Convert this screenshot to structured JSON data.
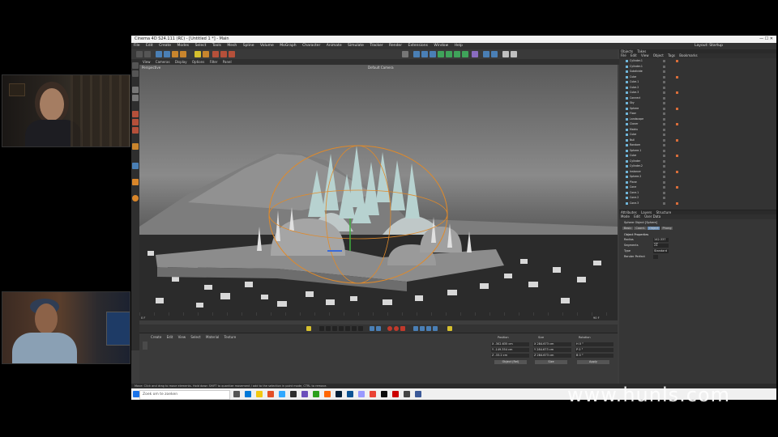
{
  "app": {
    "title": "Cinema 4D S24.111 (RC) - [Untitled 1 *] - Main",
    "menu": [
      "File",
      "Edit",
      "Create",
      "Modes",
      "Select",
      "Tools",
      "Mesh",
      "Spline",
      "Volume",
      "MoGraph",
      "Character",
      "Animate",
      "Simulate",
      "Tracker",
      "Render",
      "Extensions",
      "Window",
      "Help"
    ],
    "layout_label": "Layout: Startup"
  },
  "viewport": {
    "menu": [
      "View",
      "Cameras",
      "Display",
      "Options",
      "Filter",
      "Panel"
    ],
    "label": "Perspective",
    "camera": "Default Camera"
  },
  "timeline": {
    "start_field": "0 F",
    "end_field": "90 F"
  },
  "material_manager": {
    "menu": [
      "Create",
      "Edit",
      "View",
      "Select",
      "Material",
      "Texture"
    ]
  },
  "coordinates": {
    "headers": [
      "Position",
      "Size",
      "Rotation"
    ],
    "rows": [
      {
        "pos": "X  -302.635 cm",
        "size": "X  284.673 cm",
        "rot": "H  0 °"
      },
      {
        "pos": "Y  -149.354 cm",
        "size": "Y  284.673 cm",
        "rot": "P  0 °"
      },
      {
        "pos": "Z  -33.2 cm",
        "size": "Z  284.673 cm",
        "rot": "B  0 °"
      }
    ],
    "mode": "Object (Rel)",
    "size_mode": "Size",
    "apply": "Apply"
  },
  "object_manager": {
    "tabs": [
      "Objects",
      "Takes"
    ],
    "menu": [
      "File",
      "Edit",
      "View",
      "Object",
      "Tags",
      "Bookmarks"
    ],
    "rows": [
      "Cylinder.1",
      "Cylinder.1",
      "Subdivide",
      "Cube",
      "Cube.1",
      "Cube.2",
      "Cube.3",
      "Connect",
      "Sky",
      "Sphere",
      "Floor",
      "Landscape",
      "Cloner",
      "Matrix",
      "Cube",
      "Null",
      "Random",
      "Sphere.1",
      "Cube",
      "Cylinder",
      "Cylinder.2",
      "Instance",
      "Sphere.2",
      "Plane",
      "Cone",
      "Cone.1",
      "Cone.2",
      "Cone.3"
    ]
  },
  "attributes": {
    "tabs": [
      "Attributes",
      "Layers",
      "Structure"
    ],
    "menu": [
      "Mode",
      "Edit",
      "User Data"
    ],
    "object_title": "Sphere Object [Sphere]",
    "subtabs": [
      "Basic",
      "Coord.",
      "Object",
      "Phong"
    ],
    "section": "Object Properties",
    "props": [
      {
        "label": "Radius",
        "value": "142.337 cm"
      },
      {
        "label": "Segments",
        "value": "24"
      },
      {
        "label": "Type",
        "value": "Standard"
      },
      {
        "label": "Render Perfect",
        "value": ""
      }
    ]
  },
  "status": "Move: Click and drag to move elements. Hold down SHIFT to quantize movement / add to the selection in point mode, CTRL to remove.",
  "taskbar": {
    "search_placeholder": "Zoek om te zoeken"
  },
  "watermark": "www.hunls.com"
}
